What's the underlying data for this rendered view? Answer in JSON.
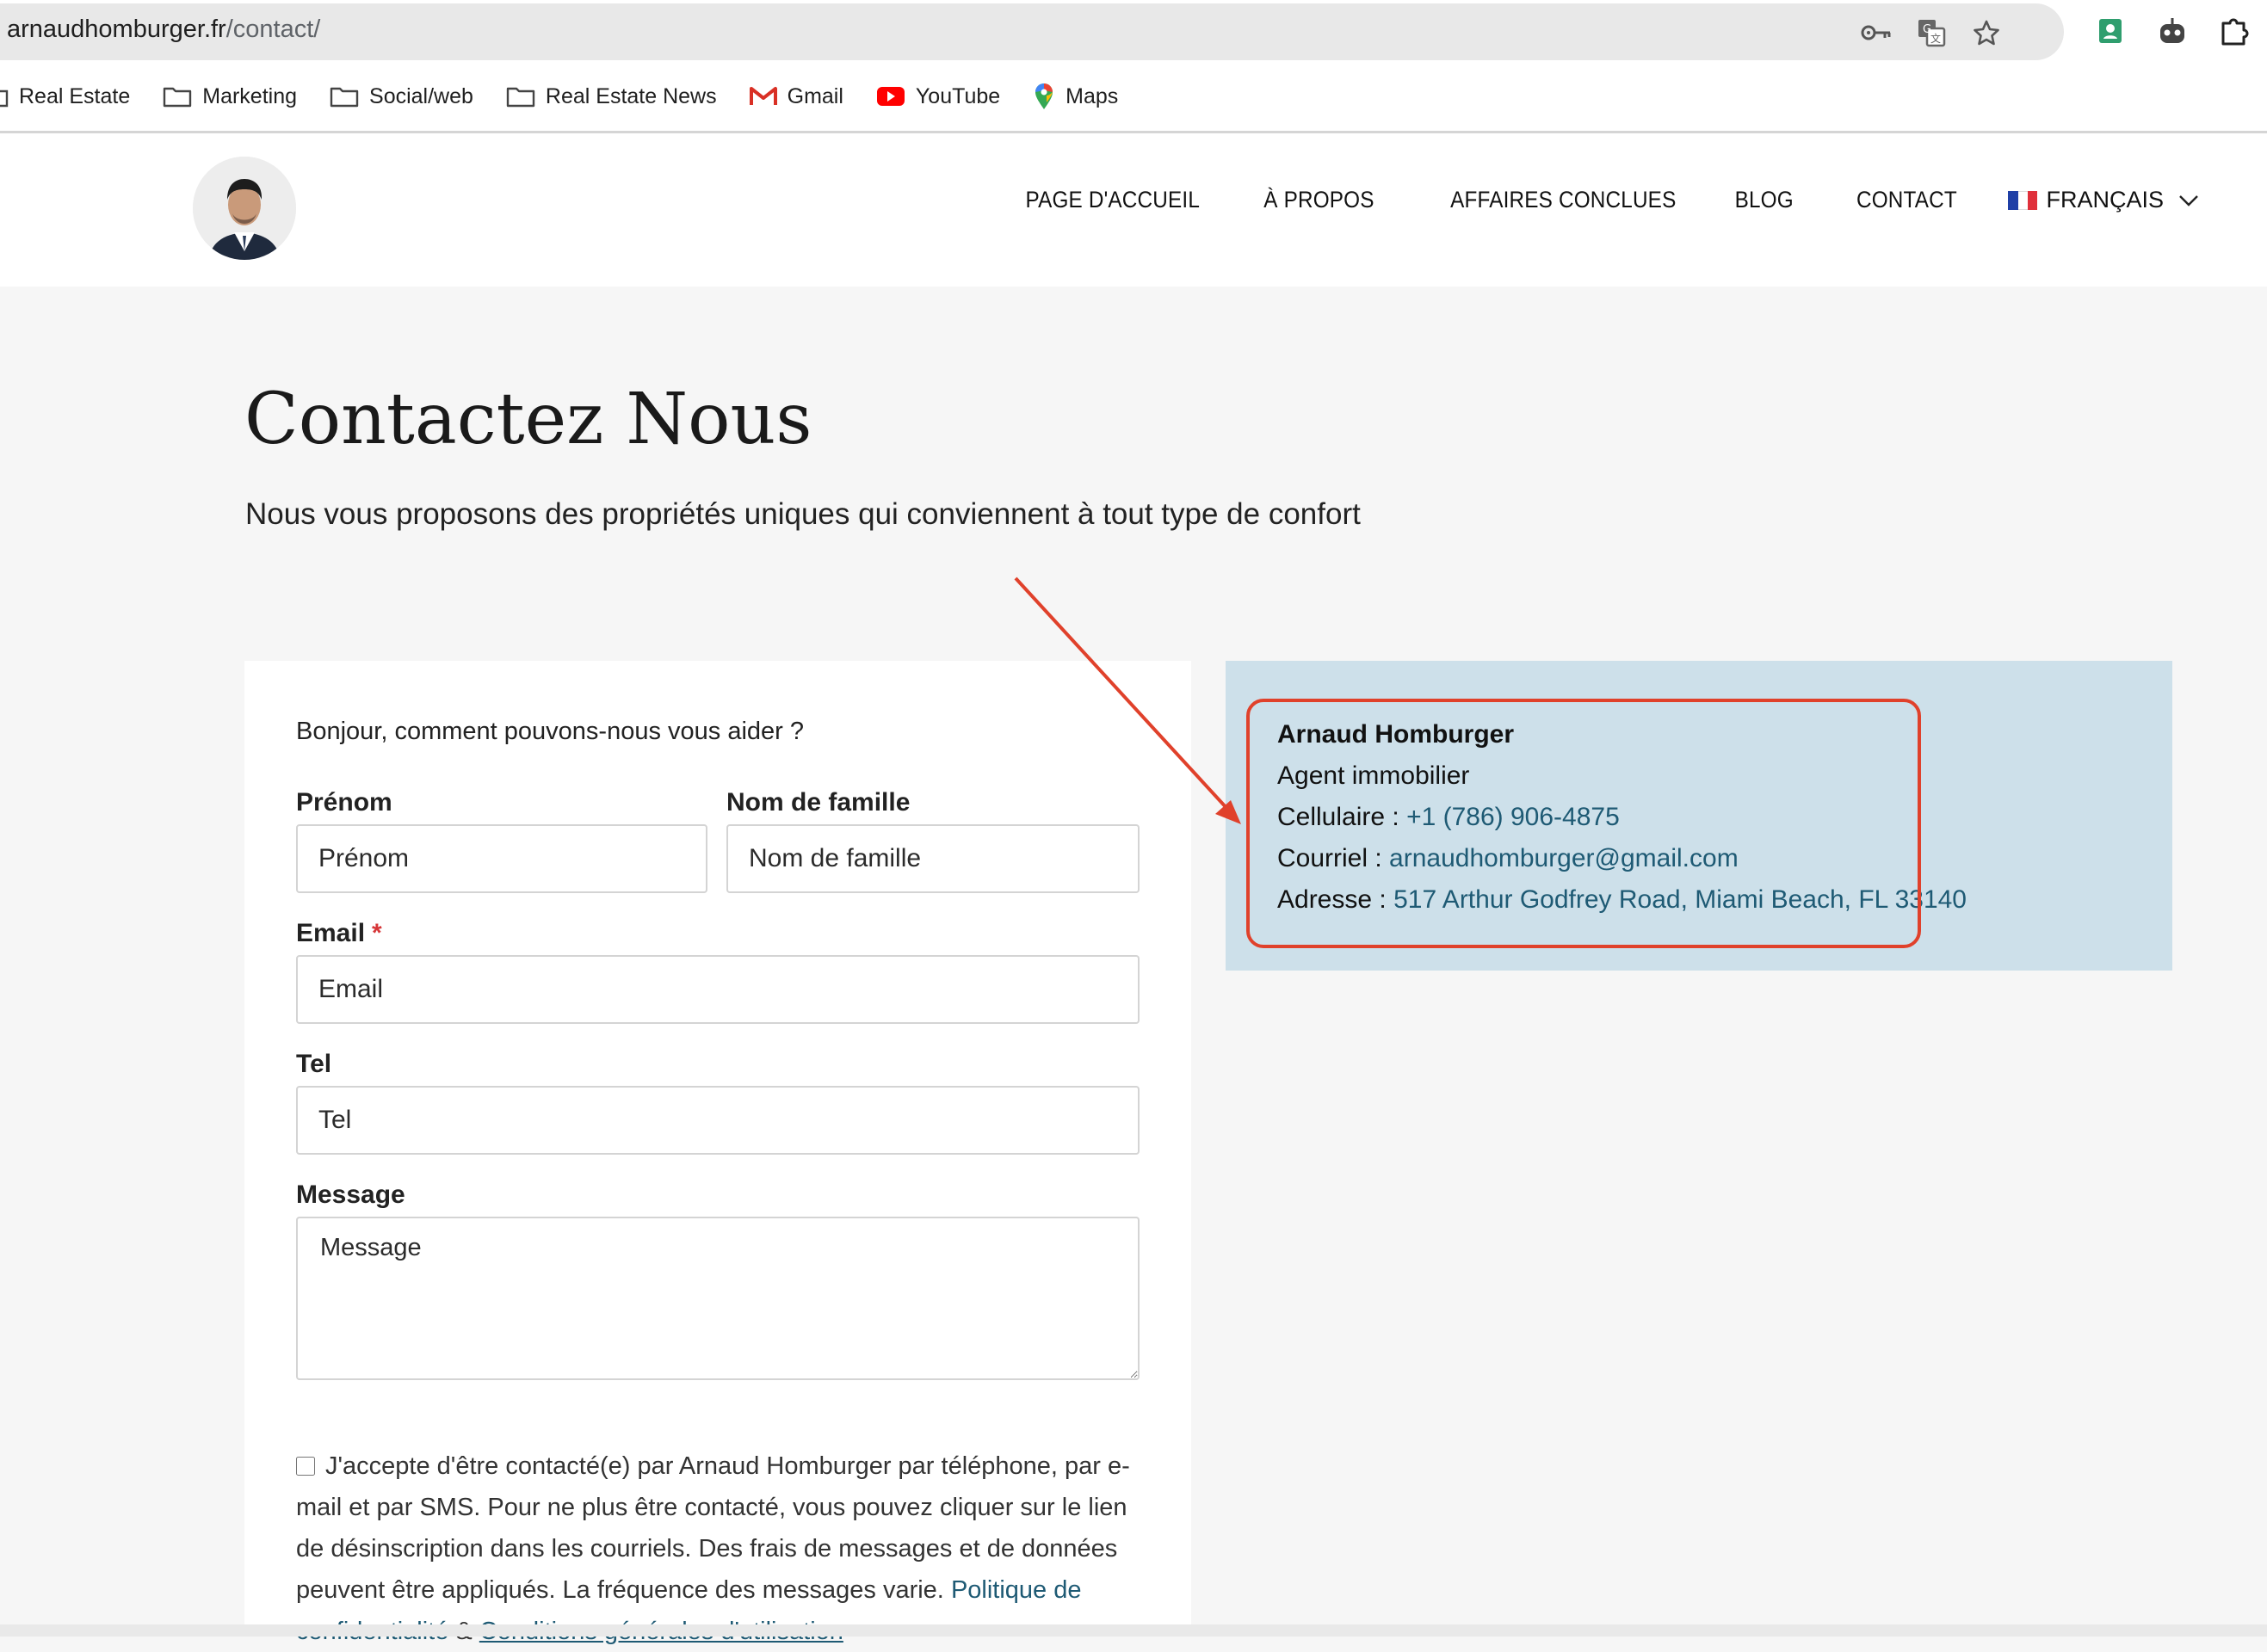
{
  "browser": {
    "url_domain": "arnaudhomburger.fr",
    "url_path": "/contact/",
    "bookmarks": [
      {
        "label": "Real Estate",
        "icon": "folder-icon"
      },
      {
        "label": "Marketing",
        "icon": "folder-icon"
      },
      {
        "label": "Social/web",
        "icon": "folder-icon"
      },
      {
        "label": "Real Estate News",
        "icon": "folder-icon"
      },
      {
        "label": "Gmail",
        "icon": "gmail-icon"
      },
      {
        "label": "YouTube",
        "icon": "youtube-icon"
      },
      {
        "label": "Maps",
        "icon": "maps-pin-icon"
      }
    ],
    "toolbar_icons": [
      "key-icon",
      "translate-icon",
      "star-icon",
      "contacts-extension-icon",
      "robot-extension-icon",
      "puzzle-extensions-icon"
    ]
  },
  "nav": {
    "items": [
      "PAGE D'ACCUEIL",
      "À PROPOS",
      "AFFAIRES CONCLUES",
      "BLOG",
      "CONTACT"
    ],
    "language": "FRANÇAIS",
    "flag_colors": [
      "#1f3fa6",
      "#ffffff",
      "#e0303b"
    ]
  },
  "page": {
    "title": "Contactez Nous",
    "subtitle": "Nous vous proposons des propriétés uniques qui conviennent à tout type de confort"
  },
  "form": {
    "intro": "Bonjour, comment pouvons-nous vous aider ?",
    "first_name": {
      "label": "Prénom",
      "placeholder": "Prénom"
    },
    "last_name": {
      "label": "Nom de famille",
      "placeholder": "Nom de famille"
    },
    "email": {
      "label": "Email",
      "required_mark": "*",
      "placeholder": "Email"
    },
    "tel": {
      "label": "Tel",
      "placeholder": "Tel"
    },
    "message": {
      "label": "Message",
      "placeholder": "Message"
    },
    "consent_text": "J'accepte d'être contacté(e) par Arnaud Homburger par téléphone, par e-mail et par SMS. Pour ne plus être contacté, vous pouvez cliquer sur le lien de désinscription dans les courriels. Des frais de messages et de données peuvent être appliqués. La fréquence des messages varie.",
    "privacy_link": "Politique de confidentialité",
    "ampersand": "&",
    "terms_link": "Conditions générales d'utilisation"
  },
  "contact_info": {
    "name": "Arnaud Homburger",
    "role": "Agent immobilier",
    "phone_label": "Cellulaire :",
    "phone": "+1 (786) 906-4875",
    "email_label": "Courriel :",
    "email": "arnaudhomburger@gmail.com",
    "address_label": "Adresse :",
    "address": "517 Arthur Godfrey Road, Miami Beach, FL 33140"
  },
  "colors": {
    "link": "#1e5a74",
    "info_bg": "#cde0ea",
    "annotation": "#e0412b",
    "required": "#d63638"
  }
}
